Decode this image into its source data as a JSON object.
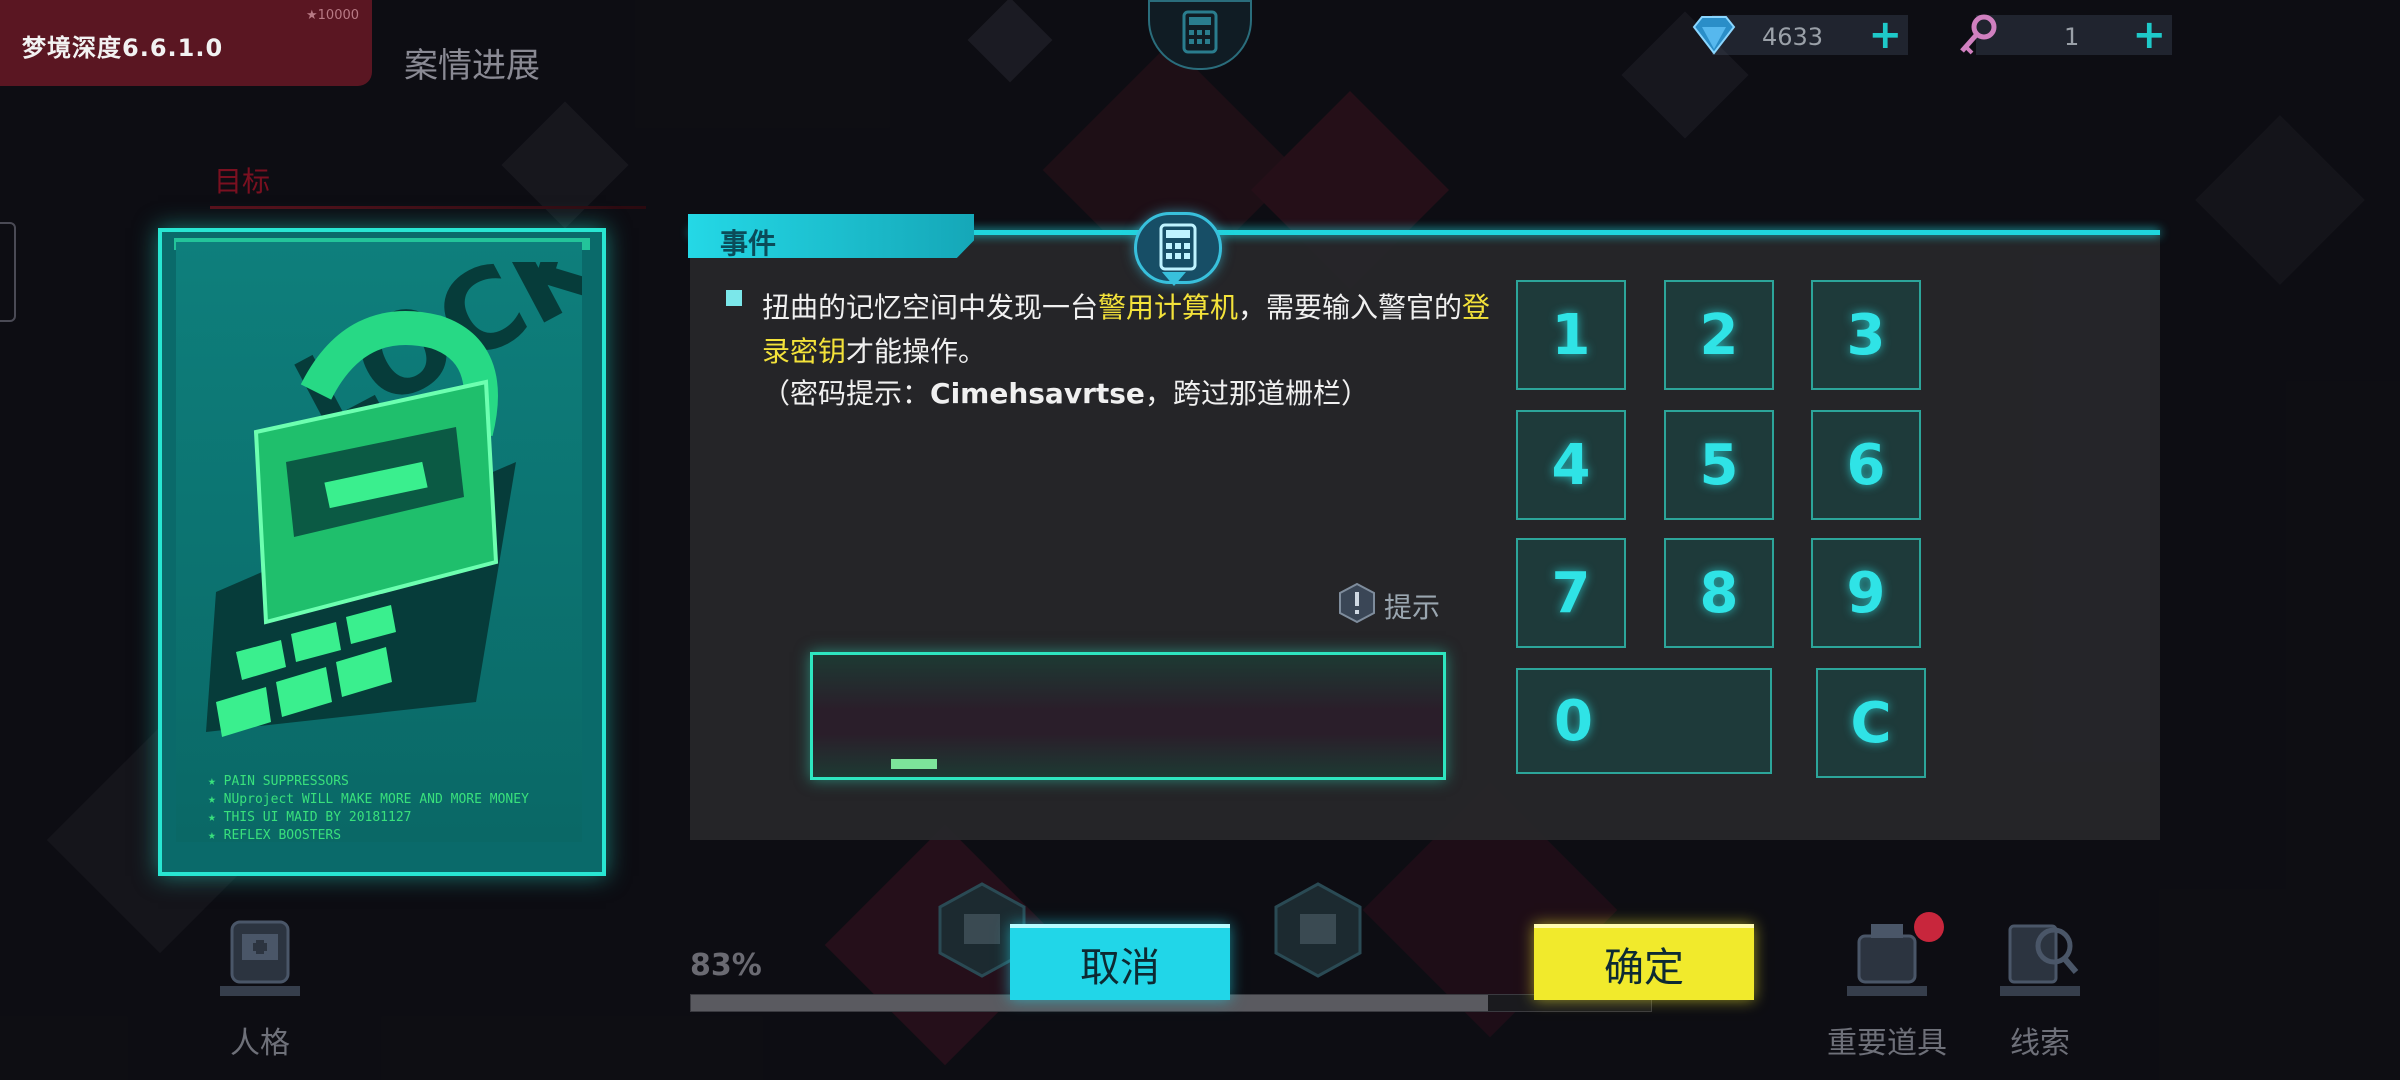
{
  "app": {
    "version_label": "梦境深度6.6.1.0",
    "version_small": "★10000",
    "page_title": "案情进展",
    "target_label": "目标"
  },
  "currency": [
    {
      "icon": "diamond-icon",
      "value": "4633"
    },
    {
      "icon": "key-icon",
      "value": "1"
    }
  ],
  "card": {
    "lines": [
      "★ PAIN SUPPRESSORS",
      "★ NUproject WILL MAKE MORE AND MORE MONEY",
      "★ THIS UI MAID BY 20181127",
      "★ REFLEX BOOSTERS"
    ]
  },
  "event": {
    "tab_label": "事件",
    "desc_part1": "扭曲的记忆空间中发现一台",
    "desc_hl1": "警用计算机",
    "desc_part2": "，需要输入警官的",
    "desc_hl2": "登录密钥",
    "desc_part3": "才能操作。",
    "hint_prefix": "（密码提示：",
    "hint_code": "Cimehsavrtse",
    "hint_suffix": "，跨过那道栅栏）",
    "hint_button": "提示",
    "input_value": ""
  },
  "keypad": {
    "keys": [
      "1",
      "2",
      "3",
      "4",
      "5",
      "6",
      "7",
      "8",
      "9"
    ],
    "zero": "0",
    "clear": "C"
  },
  "footer": {
    "progress_text": "83%",
    "progress_value": 0.83,
    "cancel_label": "取消",
    "confirm_label": "确定",
    "nav": [
      {
        "label": "人格",
        "icon": "persona-icon"
      },
      {
        "label": "重要道具",
        "icon": "key-item-icon"
      },
      {
        "label": "线索",
        "icon": "clue-icon"
      }
    ]
  },
  "colors": {
    "accent_cyan": "#21d6e8",
    "accent_yellow": "#f1ea2c",
    "highlight_text": "#f3e23a",
    "card_green": "#28e6d2"
  }
}
